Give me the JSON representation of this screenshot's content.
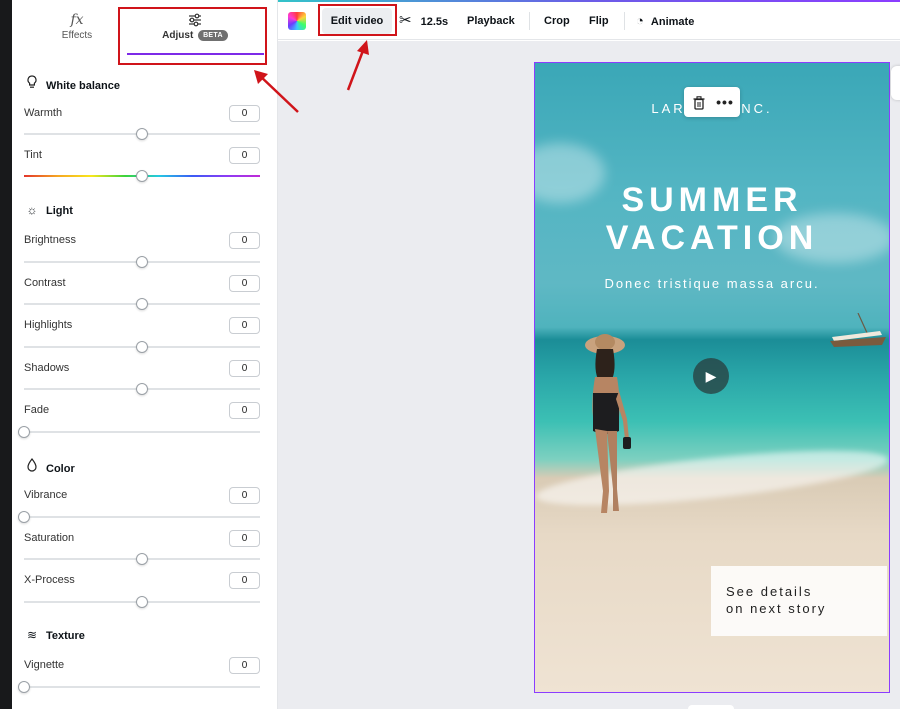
{
  "tabs": [
    {
      "label": "Effects",
      "icon": "fx-icon"
    },
    {
      "label": "Adjust",
      "badge": "BETA",
      "icon": "sliders-icon"
    }
  ],
  "sections": {
    "white_balance": "White balance",
    "light": "Light",
    "color": "Color",
    "texture": "Texture"
  },
  "adjustments": {
    "warmth": {
      "label": "Warmth",
      "value": "0"
    },
    "tint": {
      "label": "Tint",
      "value": "0"
    },
    "brightness": {
      "label": "Brightness",
      "value": "0"
    },
    "contrast": {
      "label": "Contrast",
      "value": "0"
    },
    "highlights": {
      "label": "Highlights",
      "value": "0"
    },
    "shadows": {
      "label": "Shadows",
      "value": "0"
    },
    "fade": {
      "label": "Fade",
      "value": "0"
    },
    "vibrance": {
      "label": "Vibrance",
      "value": "0"
    },
    "saturation": {
      "label": "Saturation",
      "value": "0"
    },
    "xprocess": {
      "label": "X-Process",
      "value": "0"
    },
    "vignette": {
      "label": "Vignette",
      "value": "0"
    }
  },
  "toolbar": {
    "edit_video": "Edit video",
    "duration": "12.5s",
    "playback": "Playback",
    "crop": "Crop",
    "flip": "Flip",
    "animate": "Animate"
  },
  "design": {
    "brand": "LARANA, INC.",
    "headline_1": "SUMMER",
    "headline_2": "VACATION",
    "subline": "Donec tristique massa arcu.",
    "details_1": "See details",
    "details_2": "on next story"
  },
  "colors": {
    "accent": "#8b3dff",
    "annotation": "#d0141a"
  }
}
